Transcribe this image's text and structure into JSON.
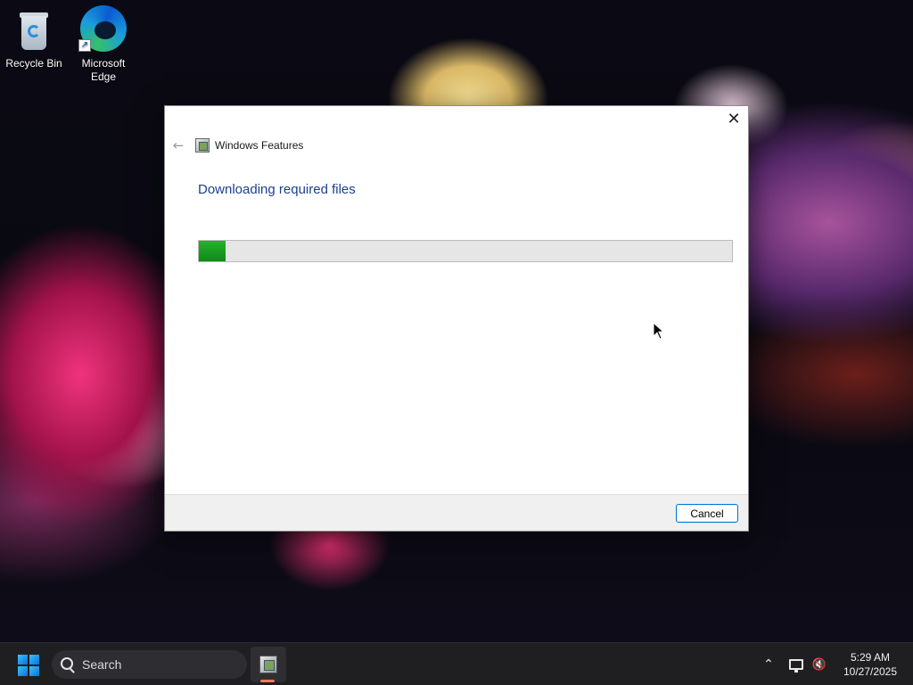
{
  "desktop": {
    "icons": [
      {
        "label": "Recycle Bin",
        "icon": "recycle-bin-icon"
      },
      {
        "label": "Microsoft Edge",
        "icon": "edge-icon",
        "shortcut_glyph": "↗"
      }
    ]
  },
  "dialog": {
    "close_glyph": "✕",
    "back_glyph": "←",
    "title": "Windows Features",
    "heading": "Downloading required files",
    "progress": 0.05,
    "cancel_label": "Cancel"
  },
  "taskbar": {
    "search_placeholder": "Search",
    "tray_chevron_glyph": "⌃",
    "sound_glyph": "🔇",
    "time": "5:29 AM",
    "date": "10/27/2025"
  },
  "colors": {
    "heading": "#1c3f8f",
    "progress_fill": "#17a11f",
    "button_border": "#0078d4",
    "taskbar": "#1f1f22"
  }
}
